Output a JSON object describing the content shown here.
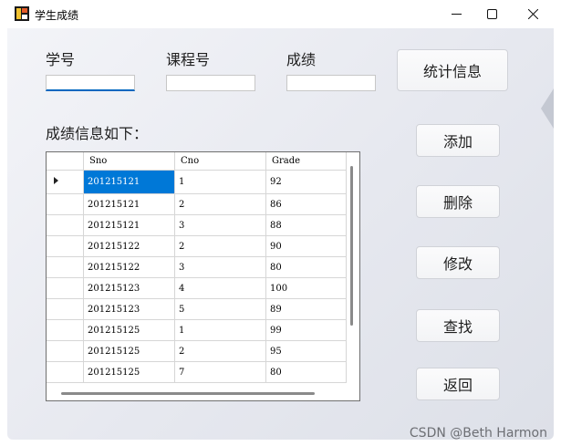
{
  "window": {
    "title": "学生成绩"
  },
  "form": {
    "sno_label": "学号",
    "cno_label": "课程号",
    "grade_label": "成绩",
    "sno_value": "",
    "cno_value": "",
    "grade_value": "",
    "grid_caption": "成绩信息如下："
  },
  "buttons": {
    "stats": "统计信息",
    "add": "添加",
    "delete": "删除",
    "modify": "修改",
    "search": "查找",
    "back": "返回"
  },
  "grid": {
    "columns": [
      "Sno",
      "Cno",
      "Grade"
    ],
    "rows": [
      [
        "201215121",
        "1",
        "92"
      ],
      [
        "201215121",
        "2",
        "86"
      ],
      [
        "201215121",
        "3",
        "88"
      ],
      [
        "201215122",
        "2",
        "90"
      ],
      [
        "201215122",
        "3",
        "80"
      ],
      [
        "201215123",
        "4",
        "100"
      ],
      [
        "201215123",
        "5",
        "89"
      ],
      [
        "201215125",
        "1",
        "99"
      ],
      [
        "201215125",
        "2",
        "95"
      ],
      [
        "201215125",
        "7",
        "80"
      ]
    ]
  },
  "watermark": "CSDN @Beth Harmon"
}
